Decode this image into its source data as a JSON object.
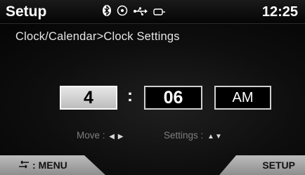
{
  "header": {
    "title": "Setup",
    "time": "12:25",
    "status_icons": [
      "bluetooth-icon",
      "disc-icon",
      "usb-icon",
      "aux-icon"
    ]
  },
  "breadcrumb": "Clock/Calendar>Clock Settings",
  "clock_settings": {
    "hour": "4",
    "separator": ":",
    "minute": "06",
    "ampm": "AM"
  },
  "hints": {
    "move_label": "Move :",
    "move_arrows": "◀ ▶",
    "settings_label": "Settings :",
    "settings_arrows": "▲▼"
  },
  "footer": {
    "back_label": "MENU",
    "back_prefix": ":",
    "setup_label": "SETUP"
  },
  "colors": {
    "selected_field": "#d0d0d0",
    "background": "#000000",
    "hint_text": "#7e7e7e",
    "button": "#a6a6a6"
  }
}
